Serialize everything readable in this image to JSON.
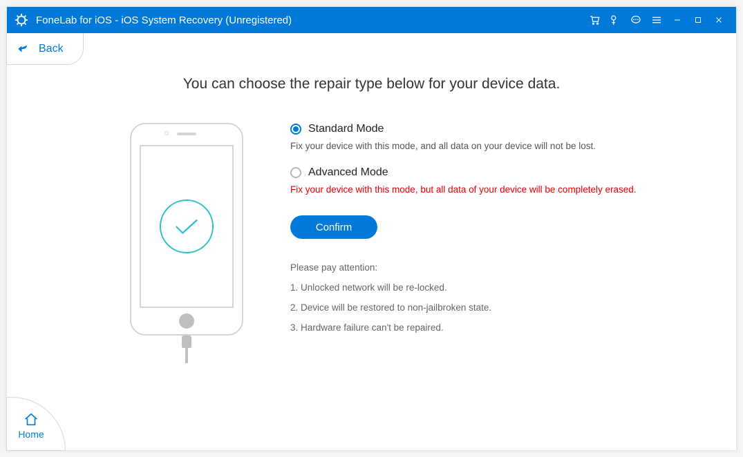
{
  "titlebar": {
    "title": "FoneLab for iOS - iOS System Recovery (Unregistered)"
  },
  "nav": {
    "back_label": "Back",
    "home_label": "Home"
  },
  "heading": "You can choose the repair type below for your device data.",
  "modes": {
    "standard": {
      "label": "Standard Mode",
      "desc": "Fix your device with this mode, and all data on your device will not be lost.",
      "selected": true
    },
    "advanced": {
      "label": "Advanced Mode",
      "desc": "Fix your device with this mode, but all data of your device will be completely erased.",
      "selected": false
    }
  },
  "confirm_label": "Confirm",
  "attention": {
    "title": "Please pay attention:",
    "items": [
      "1. Unlocked network will be re-locked.",
      "2. Device will be restored to non-jailbroken state.",
      "3. Hardware failure can't be repaired."
    ]
  }
}
